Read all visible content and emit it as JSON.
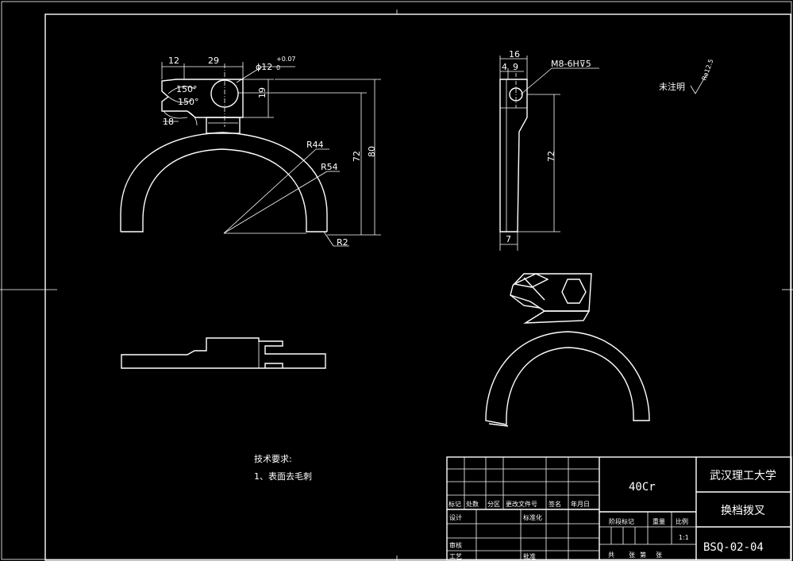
{
  "front_view": {
    "dim_12": "12",
    "dim_29": "29",
    "dim_hole": "ϕ12",
    "dim_hole_tol_upper": "+0.07",
    "dim_hole_tol_lower": "0",
    "dim_angle_a": "150°",
    "dim_angle_b": "150°",
    "dim_19": "19",
    "dim_18": "18",
    "dim_80": "80",
    "dim_72": "72",
    "dim_r44": "R44",
    "dim_r54": "R54",
    "dim_r2": "R2"
  },
  "side_view": {
    "dim_16": "16",
    "dim_4": "4",
    "dim_9": "9",
    "thread": "M8-6H⊽5",
    "dim_72": "72",
    "dim_7": "7"
  },
  "surface_note": {
    "label": "未注明",
    "symbol": "Ra12.5"
  },
  "tech_req": {
    "title": "技术要求:",
    "item1": "1、表面去毛刺"
  },
  "title_block": {
    "material": "40Cr",
    "school": "武汉理工大学",
    "part_name": "换档拨叉",
    "drawing_no": "BSQ-02-04",
    "h_biaoji": "标记",
    "h_chushu": "处数",
    "h_fenqu": "分区",
    "h_gengai": "更改文件号",
    "h_qianming": "签名",
    "h_date": "年月日",
    "sheji": "设计",
    "biaozhunhua": "标准化",
    "shenhe": "审核",
    "gongyi": "工艺",
    "pizhun": "批准",
    "jieduan": "阶段标记",
    "zhongliang": "重量",
    "bili": "比例",
    "scale_value": "1:1",
    "gong": "共",
    "zhang1": "张",
    "di": "第",
    "zhang2": "张"
  }
}
